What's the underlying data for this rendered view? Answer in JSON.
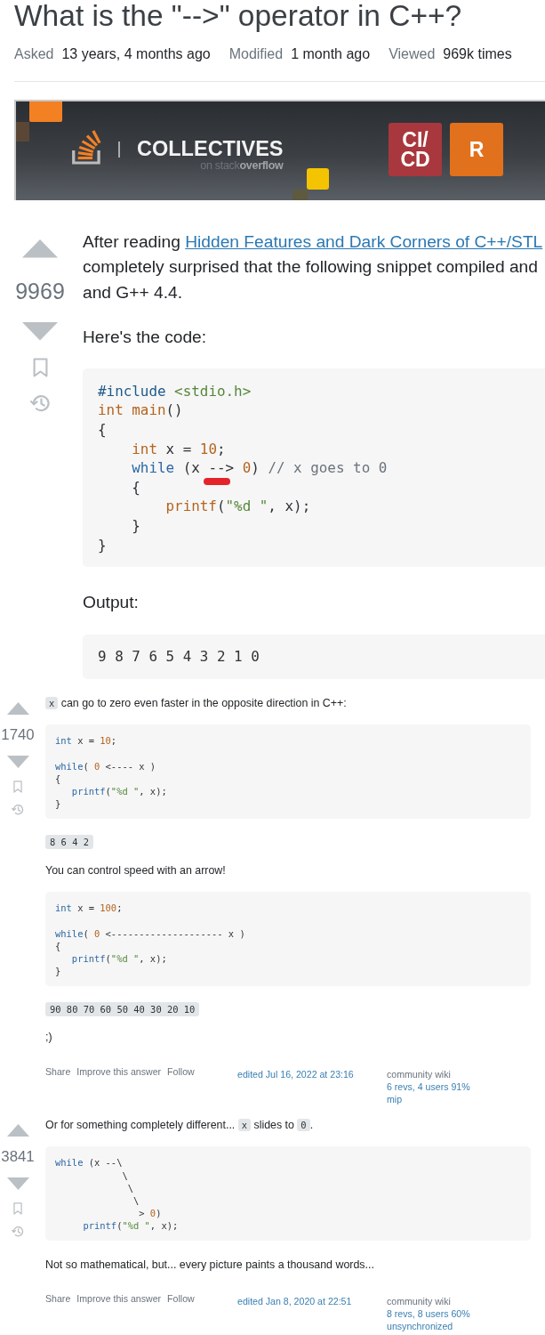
{
  "question": {
    "title": "What is the \"-->\" operator in C++?",
    "meta": [
      {
        "label": "Asked",
        "value": "13 years, 4 months ago"
      },
      {
        "label": "Modified",
        "value": "1 month ago"
      },
      {
        "label": "Viewed",
        "value": "969k times"
      }
    ],
    "banner": {
      "title": "COLLECTIVES",
      "subtitle": "on stack**overflow**",
      "tiles": [
        {
          "lines": [
            "CI/",
            "CD"
          ],
          "color": "#a8383d"
        },
        {
          "lines": [
            "R"
          ],
          "color": "#e2711d"
        }
      ]
    },
    "votes": "9969",
    "body": [
      {
        "kind": "paragraph",
        "lines": [
          [
            {
              "kind": "text",
              "text": "After reading "
            },
            {
              "kind": "link",
              "text": "Hidden Features and Dark Corners of C++/STL"
            }
          ],
          [
            {
              "kind": "text",
              "text": "completely surprised that the following snippet compiled and"
            }
          ],
          [
            {
              "kind": "text",
              "text": "and G++ 4.4."
            }
          ]
        ]
      },
      {
        "kind": "paragraph",
        "lines": [
          [
            {
              "kind": "text",
              "text": "Here's the code:"
            }
          ]
        ]
      },
      {
        "kind": "code",
        "groups": [
          {
            "lines": [
              [
                {
                  "kind": "meta",
                  "text": "#include"
                },
                {
                  "kind": "string",
                  "text": " <stdio.h>"
                }
              ],
              [
                {
                  "kind": "function",
                  "text": "int main"
                },
                {
                  "kind": "plain",
                  "text": "()"
                }
              ],
              [
                {
                  "kind": "plain",
                  "text": "{"
                }
              ],
              [
                {
                  "kind": "function",
                  "text": "    int"
                },
                {
                  "kind": "plain",
                  "text": " x = "
                },
                {
                  "kind": "number",
                  "text": "10"
                },
                {
                  "kind": "plain",
                  "text": ";"
                }
              ],
              [
                {
                  "kind": "keyword",
                  "text": "    while"
                },
                {
                  "kind": "plain",
                  "text": " (x "
                },
                {
                  "kind": "marked",
                  "text": "--"
                },
                {
                  "kind": "plain",
                  "text": "> "
                },
                {
                  "kind": "number",
                  "text": "0"
                },
                {
                  "kind": "plain",
                  "text": ") "
                },
                {
                  "kind": "comment",
                  "text": "// x goes to 0"
                }
              ],
              [
                {
                  "kind": "plain",
                  "text": "    {"
                }
              ],
              [
                {
                  "kind": "function",
                  "text": "        printf"
                },
                {
                  "kind": "plain",
                  "text": "("
                },
                {
                  "kind": "string",
                  "text": "\"%d \""
                },
                {
                  "kind": "plain",
                  "text": ", x);"
                }
              ],
              [
                {
                  "kind": "plain",
                  "text": "    }"
                }
              ],
              [
                {
                  "kind": "plain",
                  "text": "}"
                }
              ]
            ]
          }
        ]
      },
      {
        "kind": "paragraph",
        "lines": [
          [
            {
              "kind": "text",
              "text": "Output:"
            }
          ]
        ]
      },
      {
        "kind": "output",
        "text": "9 8 7 6 5 4 3 2 1 0"
      }
    ]
  },
  "answers": [
    {
      "votes": "1740",
      "body": [
        {
          "kind": "paragraph",
          "lines": [
            [
              {
                "kind": "code",
                "text": "x"
              },
              {
                "kind": "text",
                "text": " can go to zero even faster in the opposite direction in C++:"
              }
            ]
          ]
        },
        {
          "kind": "code",
          "groups": [
            {
              "lines": [
                [
                  {
                    "kind": "keyword",
                    "text": "int"
                  },
                  {
                    "kind": "plain",
                    "text": " x = "
                  },
                  {
                    "kind": "number",
                    "text": "10"
                  },
                  {
                    "kind": "plain",
                    "text": ";"
                  }
                ]
              ]
            },
            {
              "lines": [
                [
                  {
                    "kind": "keyword",
                    "text": "while"
                  },
                  {
                    "kind": "plain",
                    "text": "( "
                  },
                  {
                    "kind": "number",
                    "text": "0"
                  },
                  {
                    "kind": "plain",
                    "text": " <---- x )"
                  }
                ],
                [
                  {
                    "kind": "plain",
                    "text": "{"
                  }
                ],
                [
                  {
                    "kind": "keyword",
                    "text": "   printf"
                  },
                  {
                    "kind": "plain",
                    "text": "("
                  },
                  {
                    "kind": "string",
                    "text": "\"%d \""
                  },
                  {
                    "kind": "plain",
                    "text": ", x);"
                  }
                ],
                [
                  {
                    "kind": "plain",
                    "text": "}"
                  }
                ]
              ]
            }
          ]
        },
        {
          "kind": "result",
          "text": "8 6 4 2"
        },
        {
          "kind": "paragraph",
          "lines": [
            [
              {
                "kind": "text",
                "text": "You can control speed with an arrow!"
              }
            ]
          ]
        },
        {
          "kind": "code",
          "groups": [
            {
              "lines": [
                [
                  {
                    "kind": "keyword",
                    "text": "int"
                  },
                  {
                    "kind": "plain",
                    "text": " x = "
                  },
                  {
                    "kind": "number",
                    "text": "100"
                  },
                  {
                    "kind": "plain",
                    "text": ";"
                  }
                ]
              ]
            },
            {
              "lines": [
                [
                  {
                    "kind": "keyword",
                    "text": "while"
                  },
                  {
                    "kind": "plain",
                    "text": "( "
                  },
                  {
                    "kind": "number",
                    "text": "0"
                  },
                  {
                    "kind": "plain",
                    "text": " <-------------------- x )"
                  }
                ],
                [
                  {
                    "kind": "plain",
                    "text": "{"
                  }
                ],
                [
                  {
                    "kind": "keyword",
                    "text": "   printf"
                  },
                  {
                    "kind": "plain",
                    "text": "("
                  },
                  {
                    "kind": "string",
                    "text": "\"%d \""
                  },
                  {
                    "kind": "plain",
                    "text": ", x);"
                  }
                ],
                [
                  {
                    "kind": "plain",
                    "text": "}"
                  }
                ]
              ]
            }
          ]
        },
        {
          "kind": "result",
          "text": "90 80 70 60 50 40 30 20 10"
        },
        {
          "kind": "paragraph",
          "lines": [
            [
              {
                "kind": "text",
                "text": ";)"
              }
            ]
          ]
        }
      ],
      "footer": {
        "actions": [
          "Share",
          "Improve this answer",
          "Follow"
        ],
        "edited": "edited Jul 16, 2022 at 23:16",
        "wiki": "community wiki",
        "revisions": "6 revs, 4 users 91%",
        "user": "mip"
      }
    },
    {
      "votes": "3841",
      "body": [
        {
          "kind": "paragraph",
          "lines": [
            [
              {
                "kind": "text",
                "text": "Or for something completely different... "
              },
              {
                "kind": "code",
                "text": "x"
              },
              {
                "kind": "text",
                "text": " slides to "
              },
              {
                "kind": "code",
                "text": "0"
              },
              {
                "kind": "text",
                "text": "."
              }
            ]
          ]
        },
        {
          "kind": "code",
          "groups": [
            {
              "lines": [
                [
                  {
                    "kind": "keyword",
                    "text": "while"
                  },
                  {
                    "kind": "plain",
                    "text": " (x --\\"
                  }
                ],
                [
                  {
                    "kind": "plain",
                    "text": "            \\"
                  }
                ],
                [
                  {
                    "kind": "plain",
                    "text": "             \\"
                  }
                ],
                [
                  {
                    "kind": "plain",
                    "text": "              \\"
                  }
                ],
                [
                  {
                    "kind": "plain",
                    "text": "               > "
                  },
                  {
                    "kind": "number",
                    "text": "0"
                  },
                  {
                    "kind": "plain",
                    "text": ")"
                  }
                ],
                [
                  {
                    "kind": "keyword",
                    "text": "     printf"
                  },
                  {
                    "kind": "plain",
                    "text": "("
                  },
                  {
                    "kind": "string",
                    "text": "\"%d \""
                  },
                  {
                    "kind": "plain",
                    "text": ", x);"
                  }
                ]
              ]
            }
          ]
        },
        {
          "kind": "paragraph",
          "lines": [
            [
              {
                "kind": "text",
                "text": "Not so mathematical, but... every picture paints a thousand words..."
              }
            ]
          ]
        }
      ],
      "footer": {
        "actions": [
          "Share",
          "Improve this answer",
          "Follow"
        ],
        "edited": "edited Jan 8, 2020 at 22:51",
        "wiki": "community wiki",
        "revisions": "8 revs, 8 users 60%",
        "user": "unsynchronized"
      }
    }
  ]
}
